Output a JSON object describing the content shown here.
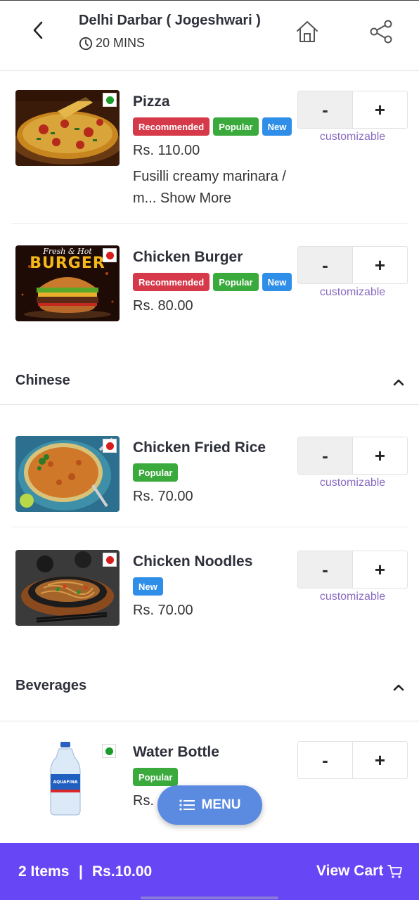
{
  "header": {
    "title": "Delhi Darbar ( Jogeshwari )",
    "eta": "20 MINS"
  },
  "tags": {
    "recommended": "Recommended",
    "popular": "Popular",
    "new": "New"
  },
  "stepper": {
    "minus": "-",
    "plus": "+"
  },
  "customizable": "customizable",
  "items": [
    {
      "name": "Pizza",
      "price": "Rs. 110.00",
      "desc": "Fusilli creamy marinara / m...",
      "show_more": "Show More",
      "diet": "veg"
    },
    {
      "name": "Chicken Burger",
      "price": "Rs. 80.00",
      "diet": "non-veg",
      "image_text_line1": "Fresh & Hot",
      "image_text_line2": "BURGER"
    },
    {
      "name": "Chicken Fried Rice",
      "price": "Rs. 70.00",
      "diet": "non-veg"
    },
    {
      "name": "Chicken Noodles",
      "price": "Rs. 70.00",
      "diet": "non-veg"
    },
    {
      "name": "Water Bottle",
      "price": "Rs. ",
      "diet": "veg",
      "image_text": "AQUAFINA"
    }
  ],
  "sections": {
    "chinese": "Chinese",
    "beverages": "Beverages"
  },
  "menu_button": "MENU",
  "cart": {
    "count": "2 Items",
    "separator": "|",
    "total": "Rs.10.00",
    "view_label": "View Cart"
  },
  "colors": {
    "recommended": "#d63a4a",
    "popular": "#3aaa3d",
    "new": "#2f8fe8",
    "veg_dot": "#1a9b2a",
    "nonveg_dot": "#d81d1d",
    "cart_bar": "#6746f5",
    "menu_fab": "#5b8be0",
    "customizable": "#8a6bc2"
  }
}
